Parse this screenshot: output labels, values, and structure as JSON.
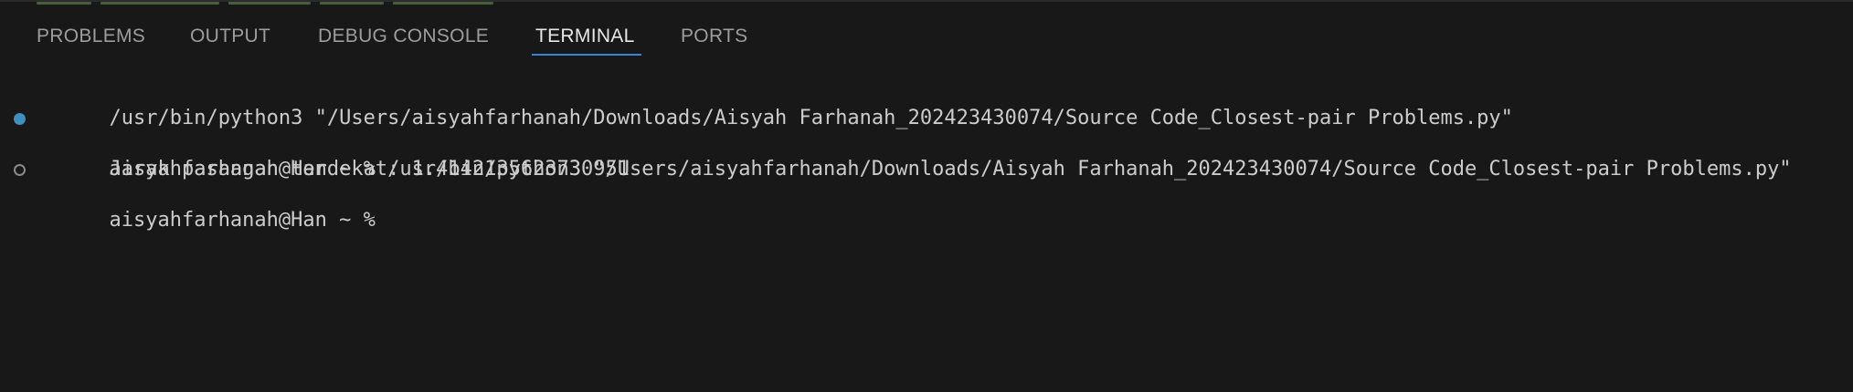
{
  "tabs": [
    {
      "label": "PROBLEMS",
      "active": false
    },
    {
      "label": "OUTPUT",
      "active": false
    },
    {
      "label": "DEBUG CONSOLE",
      "active": false
    },
    {
      "label": "TERMINAL",
      "active": true
    },
    {
      "label": "PORTS",
      "active": false
    }
  ],
  "colors": {
    "background": "#181818",
    "active_tab_underline": "#3b82d6",
    "success_decoration": "#3f8fc0",
    "text": "#cccccc"
  },
  "terminal": {
    "lines": [
      {
        "text": "/usr/bin/python3 \"/Users/aisyahfarhanah/Downloads/Aisyah Farhanah_202423430074/Source Code_Closest-pair Problems.py\"",
        "decoration": "none"
      },
      {
        "text": "aisyahfarhanah@Han ~ % /usr/bin/python3 \"/Users/aisyahfarhanah/Downloads/Aisyah Farhanah_202423430074/Source Code_Closest-pair Problems.py\"",
        "decoration": "success-circle-icon"
      },
      {
        "text": "Jarak pasangan terdekat: 1.4142135623730951",
        "decoration": "none"
      },
      {
        "text": "aisyahfarhanah@Han ~ % ",
        "decoration": "empty-circle-icon"
      }
    ]
  }
}
